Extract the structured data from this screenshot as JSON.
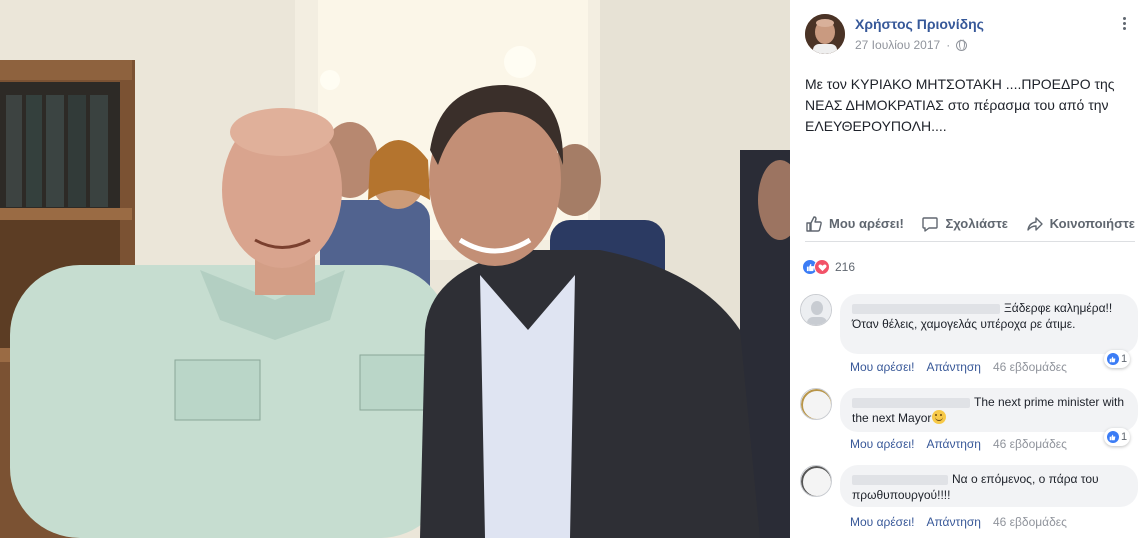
{
  "post": {
    "author": "Χρήστος Πριονίδης",
    "date": "27 Ιουλίου 2017",
    "privacy_icon": "globe-icon",
    "text": "Με τον ΚΥΡΙΑΚΟ ΜΗΤΣΟΤΑΚΗ ....ΠΡΟΕΔΡΟ της ΝΕΑΣ ΔΗΜΟΚΡΑΤΙΑΣ στο πέρασμα του από την ΕΛΕΥΘΕΡΟΥΠΟΛΗ...."
  },
  "actions": {
    "like": "Μου αρέσει!",
    "comment": "Σχολιάστε",
    "share": "Κοινοποιήστε"
  },
  "reactions": {
    "count": "216",
    "types": [
      "like",
      "love"
    ],
    "colors": {
      "like": "#3b7cf5",
      "love": "#f25268"
    }
  },
  "comments": [
    {
      "text": "Ξάδερφε καλημέρα!! Όταν θέλεις, χαμογελάς υπέροχα ρε άτιμε.",
      "like_label": "Μου αρέσει!",
      "reply_label": "Απάντηση",
      "time": "46 εβδομάδες",
      "likes": "1"
    },
    {
      "text": "The next prime minister with the next Mayor",
      "like_label": "Μου αρέσει!",
      "reply_label": "Απάντηση",
      "time": "46 εβδομάδες",
      "likes": "1"
    },
    {
      "text": "Να ο επόμενος, ο πάρα του πρωθυπουργού!!!!",
      "like_label": "Μου αρέσει!",
      "reply_label": "Απάντηση",
      "time": "46 εβδομάδες",
      "likes": ""
    }
  ],
  "colors": {
    "author_link": "#365899",
    "secondary_text": "#90949c",
    "comment_bubble": "#f2f3f5"
  }
}
